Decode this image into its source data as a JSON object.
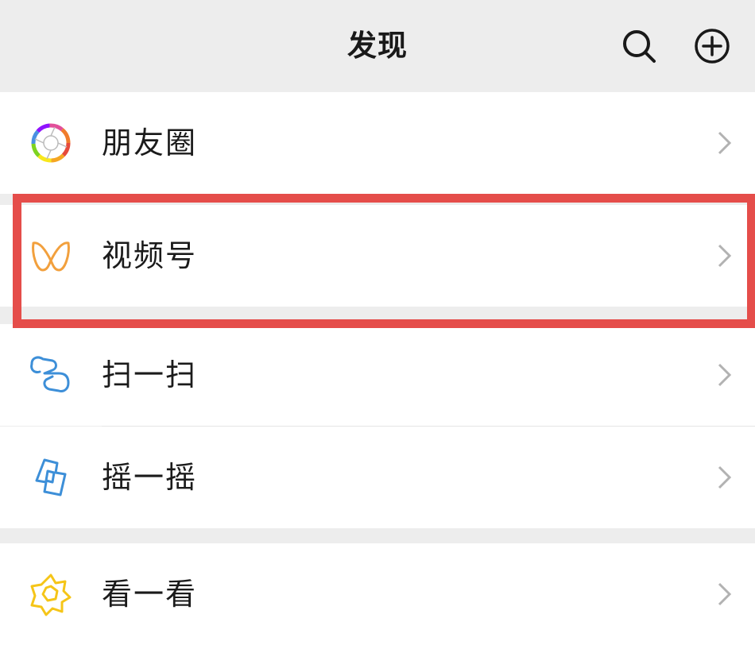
{
  "header": {
    "title": "发现",
    "search_icon": "search-icon",
    "add_icon": "plus-circle-icon"
  },
  "menu": {
    "items": [
      {
        "label": "朋友圈",
        "icon": "moments-icon"
      },
      {
        "label": "视频号",
        "icon": "channels-icon"
      },
      {
        "label": "扫一扫",
        "icon": "scan-icon"
      },
      {
        "label": "摇一摇",
        "icon": "shake-icon"
      },
      {
        "label": "看一看",
        "icon": "top-stories-icon"
      }
    ],
    "chevron_icon": "chevron-right-icon"
  },
  "colors": {
    "background": "#ededed",
    "card": "#ffffff",
    "highlight": "#e54d4a",
    "channels": "#f2a03d",
    "scan_blue": "#3d8fd8",
    "top_stories": "#f5c518"
  },
  "highlighted_item": "视频号"
}
